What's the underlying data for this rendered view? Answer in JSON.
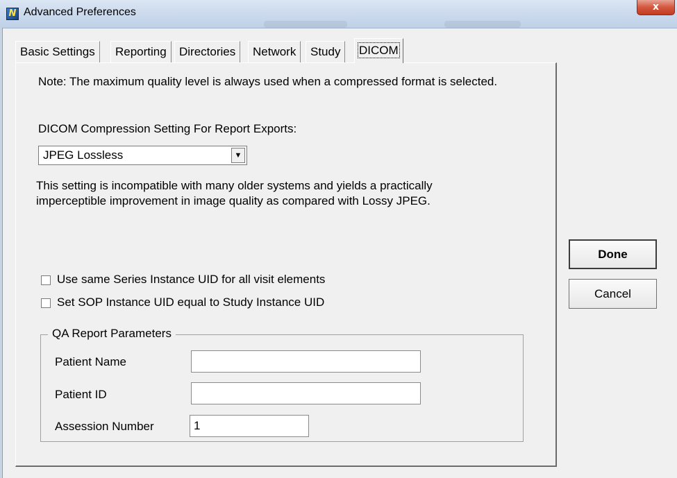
{
  "window": {
    "title": "Advanced Preferences",
    "icon": "app-logo-icon",
    "close_glyph": "x"
  },
  "tabs": [
    {
      "label": "Basic Settings"
    },
    {
      "label": "Reporting"
    },
    {
      "label": "Directories"
    },
    {
      "label": "Network"
    },
    {
      "label": "Study"
    },
    {
      "label": "DICOM",
      "active": true
    }
  ],
  "dicom": {
    "note": "Note: The maximum quality level is always used when a compressed format is selected.",
    "compression_label": "DICOM Compression Setting For Report Exports:",
    "compression_value": "JPEG Lossless",
    "compression_description_line1": "This setting is incompatible with many older systems and yields a practically",
    "compression_description_line2": "imperceptible improvement in image quality as compared with Lossy JPEG.",
    "checkbox_series_uid": "Use same Series Instance UID for all  visit elements",
    "checkbox_series_uid_checked": false,
    "checkbox_sop_uid": "Set SOP Instance UID equal to Study Instance UID",
    "checkbox_sop_uid_checked": false
  },
  "qa": {
    "group_title": "QA Report Parameters",
    "patient_name_label": "Patient Name",
    "patient_name_value": "",
    "patient_id_label": "Patient ID",
    "patient_id_value": "",
    "assession_label": "Assession Number",
    "assession_value": "1"
  },
  "buttons": {
    "done": "Done",
    "cancel": "Cancel"
  }
}
